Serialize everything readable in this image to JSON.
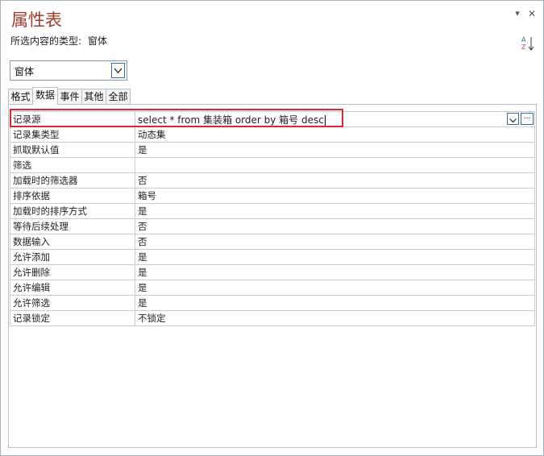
{
  "window": {
    "title": "属性表",
    "selection_type_label": "所选内容的类型:",
    "selection_type_value": "窗体",
    "menu_glyph": "▾",
    "close_glyph": "✕"
  },
  "object_selector": {
    "value": "窗体"
  },
  "tabs": [
    {
      "label": "格式",
      "active": false
    },
    {
      "label": "数据",
      "active": true
    },
    {
      "label": "事件",
      "active": false
    },
    {
      "label": "其他",
      "active": false
    },
    {
      "label": "全部",
      "active": false
    }
  ],
  "properties": [
    {
      "name": "记录源",
      "value": "select * from 集装箱 order by 箱号 desc"
    },
    {
      "name": "记录集类型",
      "value": "动态集"
    },
    {
      "name": "抓取默认值",
      "value": "是"
    },
    {
      "name": "筛选",
      "value": ""
    },
    {
      "name": "加载时的筛选器",
      "value": "否"
    },
    {
      "name": "排序依据",
      "value": "箱号"
    },
    {
      "name": "加载时的排序方式",
      "value": "是"
    },
    {
      "name": "等待后续处理",
      "value": "否"
    },
    {
      "name": "数据输入",
      "value": "否"
    },
    {
      "name": "允许添加",
      "value": "是"
    },
    {
      "name": "允许删除",
      "value": "是"
    },
    {
      "name": "允许编辑",
      "value": "是"
    },
    {
      "name": "允许筛选",
      "value": "是"
    },
    {
      "name": "记录锁定",
      "value": "不锁定"
    }
  ],
  "builder_button_label": "...",
  "colors": {
    "title": "#a33a2a",
    "highlight": "#e0242c",
    "accent": "#2f6fb5"
  },
  "icons": {
    "sort": "sort-ascending-icon"
  }
}
